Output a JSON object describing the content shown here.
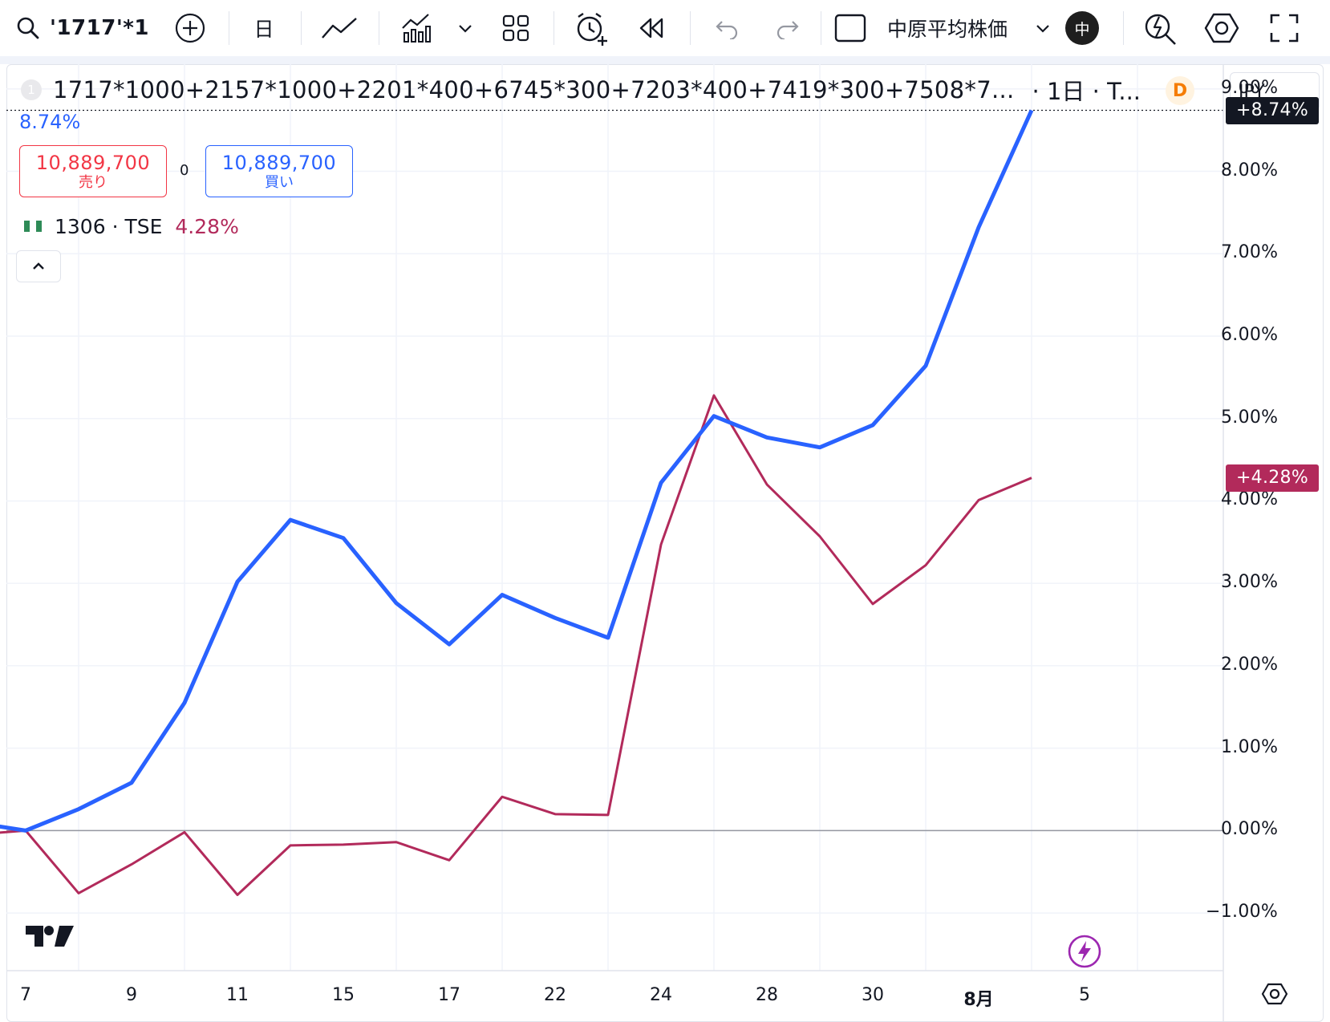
{
  "toolbar": {
    "symbol": "'1717'*1",
    "timeframe": "日",
    "index_name": "中原平均株価",
    "avatar": "中",
    "icons": [
      "search-icon",
      "add-symbol-icon",
      "line-chart-icon",
      "indicators-icon",
      "chevron-down-icon",
      "layouts-icon",
      "alert-icon",
      "replay-icon",
      "undo-icon",
      "redo-icon",
      "square-icon",
      "chevron-down-icon",
      "quick-search-icon",
      "settings-icon",
      "fullscreen-icon"
    ]
  },
  "legend": {
    "number": "1",
    "title": "1717*1000+2157*1000+2201*400+6745*300+7203*400+7419*300+7508*7...",
    "interval": "· 1日 · T...",
    "badge": "D",
    "main_change": "8.74%",
    "sell_price": "10,889,700",
    "sell_label": "売り",
    "spread": "0",
    "buy_price": "10,889,700",
    "buy_label": "買い",
    "compare_symbol": "1306 · TSE",
    "compare_change": "4.28%"
  },
  "scale": {
    "currency": "JPY",
    "main_badge": "+8.74%",
    "compare_badge": "+4.28%",
    "main_color": "#2962ff",
    "compare_color": "#b22a5b"
  },
  "chart_data": {
    "type": "line",
    "y_unit": "%",
    "ylim": [
      -1.7,
      9.3
    ],
    "y_ticks": [
      "9.00%",
      "8.00%",
      "7.00%",
      "6.00%",
      "5.00%",
      "4.00%",
      "3.00%",
      "2.00%",
      "1.00%",
      "0.00%",
      "−1.00%"
    ],
    "y_tick_values": [
      9,
      8,
      7,
      6,
      5,
      4,
      3,
      2,
      1,
      0,
      -1
    ],
    "x_tick_labels": [
      "7",
      "9",
      "11",
      "15",
      "17",
      "22",
      "24",
      "28",
      "30",
      "8月",
      "5"
    ],
    "grid": true,
    "legend": "top-left",
    "series": [
      {
        "name": "1717*1000+2157*1000+2201*400+6745*300+7203*400+7419*300+7508*7...",
        "color": "#2962ff",
        "values": [
          0.1,
          0.0,
          0.26,
          0.58,
          1.55,
          3.02,
          3.77,
          3.55,
          2.76,
          2.26,
          2.86,
          2.58,
          2.34,
          4.22,
          5.03,
          4.77,
          4.65,
          4.92,
          5.64,
          7.32,
          8.74
        ]
      },
      {
        "name": "1306 · TSE",
        "color": "#b22a5b",
        "values": [
          -0.05,
          0.0,
          -0.76,
          -0.41,
          -0.02,
          -0.78,
          -0.18,
          -0.17,
          -0.14,
          -0.36,
          0.41,
          0.2,
          0.19,
          3.47,
          5.28,
          4.2,
          3.57,
          2.75,
          3.22,
          4.01,
          4.28
        ]
      }
    ]
  }
}
